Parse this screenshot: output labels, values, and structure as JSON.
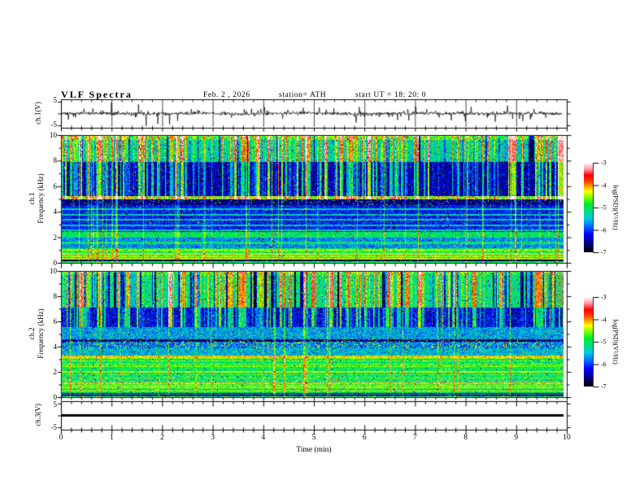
{
  "header": {
    "title": "VLF Spectra",
    "date": "Feb. 2 , 2026",
    "station": "station= ATH",
    "start_ut": "start UT =  18: 20: 0"
  },
  "x_axis": {
    "label": "Time (min)",
    "ticks": [
      "0",
      "1",
      "2",
      "3",
      "4",
      "5",
      "6",
      "7",
      "8",
      "9",
      "10"
    ],
    "range_min": [
      0,
      10
    ],
    "minor_step_min": 0.2
  },
  "panels": {
    "ch1_wave": {
      "ylabel": "ch.1(V)",
      "yticks": [
        "5",
        "-5"
      ],
      "ylim": [
        -5,
        5
      ]
    },
    "spec1": {
      "ylabel_line1": "ch.1",
      "ylabel_line2": "Frequency (kHz)",
      "yticks": [
        "10",
        "8",
        "6",
        "4",
        "2",
        "0"
      ],
      "ylim_khz": [
        0,
        10
      ]
    },
    "spec2": {
      "ylabel_line1": "ch.2",
      "ylabel_line2": "Frequency (kHz)",
      "yticks": [
        "10",
        "8",
        "6",
        "4",
        "2",
        "0"
      ],
      "ylim_khz": [
        0,
        10
      ]
    },
    "ch3_wave": {
      "ylabel": "ch.3(V)",
      "yticks": [
        "5",
        "-5"
      ],
      "ylim": [
        -5,
        5
      ]
    }
  },
  "colorbar": {
    "label": "log(PSD)(V²/Hz)",
    "ticks": [
      "-3",
      "-4",
      "-5",
      "-6",
      "-7"
    ],
    "range": [
      -7,
      -3
    ],
    "colormap": [
      [
        0.0,
        "#000000"
      ],
      [
        0.1,
        "#000085"
      ],
      [
        0.2,
        "#0000ff"
      ],
      [
        0.3,
        "#0077ff"
      ],
      [
        0.38,
        "#00ccdd"
      ],
      [
        0.46,
        "#00dd88"
      ],
      [
        0.54,
        "#00ee22"
      ],
      [
        0.62,
        "#88ff00"
      ],
      [
        0.68,
        "#ffff00"
      ],
      [
        0.74,
        "#ff9900"
      ],
      [
        0.8,
        "#ff3300"
      ],
      [
        0.86,
        "#ff0000"
      ],
      [
        0.93,
        "#ff99aa"
      ],
      [
        1.0,
        "#ffffff"
      ]
    ]
  },
  "chart_data": [
    {
      "type": "line",
      "panel": "ch1-waveform",
      "ylabel": "ch.1(V)",
      "ylim": [
        -5,
        5
      ],
      "x_range_min": [
        0,
        9.85
      ],
      "description": "Noisy time series centered on 0 V with frequent impulsive spikes up to about ±4 V",
      "baseline": 0,
      "noise_sd": 0.5,
      "spike_count": 100,
      "spike_max": 4.3,
      "seed": 5,
      "color": "#000000"
    },
    {
      "type": "heatmap",
      "panel": "ch1-spectrogram",
      "ylabel": "ch.1 Frequency (kHz)",
      "ylim_khz": [
        0,
        10
      ],
      "x_range_min": [
        0,
        9.85
      ],
      "value_range_logpsd": [
        -7,
        -3
      ],
      "seed": 11,
      "bands": [
        {
          "f": [
            5.05,
            5.3
          ],
          "level": -4.55,
          "noise": 0.55
        },
        {
          "f": [
            2.2,
            2.45
          ],
          "level": -5.0,
          "noise": 0.3
        },
        {
          "f": [
            0.95,
            1.1
          ],
          "level": -4.55,
          "noise": 0.3
        },
        {
          "f": [
            0.68,
            0.78
          ],
          "level": -4.3,
          "noise": 0.25
        },
        {
          "f": [
            0.5,
            0.6
          ],
          "level": -4.5,
          "noise": 0.3
        },
        {
          "f": [
            0.32,
            0.42
          ],
          "level": -4.35,
          "noise": 0.3
        },
        {
          "f": [
            0.06,
            0.14
          ],
          "level": -5.0,
          "noise": 0.3
        },
        {
          "f": [
            9.7,
            10.01
          ],
          "level": -4.75,
          "noise": 0.55
        },
        {
          "f": [
            8.0,
            9.7
          ],
          "level": -5.3,
          "noise": 0.5
        },
        {
          "f": [
            5.3,
            8.0
          ],
          "level": -6.45,
          "noise": 0.45
        },
        {
          "f": [
            4.6,
            5.05
          ],
          "level": -6.6,
          "noise": 0.35,
          "speck": {
            "prob": 0.05,
            "level": -4.6
          }
        },
        {
          "f": [
            2.45,
            4.6
          ],
          "level": -6.15,
          "noise": 0.4,
          "stripes": {
            "period": 0.42,
            "frac": 0.3,
            "amp": 0.8
          }
        },
        {
          "f": [
            1.1,
            2.2
          ],
          "level": -5.7,
          "noise": 0.4,
          "stripes": {
            "period": 0.5,
            "frac": 0.4,
            "amp": 0.6
          }
        },
        {
          "f": [
            0.78,
            0.95
          ],
          "level": -4.95,
          "noise": 0.3
        },
        {
          "f": [
            0.6,
            0.68
          ],
          "level": -5.2,
          "noise": 0.3
        },
        {
          "f": [
            0.42,
            0.5
          ],
          "level": -5.1,
          "noise": 0.3
        },
        {
          "f": [
            0.14,
            0.32
          ],
          "level": -6.85,
          "noise": 0.25
        },
        {
          "f": [
            0.0,
            0.06
          ],
          "level": -7.0,
          "noise": 0.1
        }
      ],
      "streaks": {
        "fmin": 5.05,
        "bright_prob": 0.55,
        "bright_amp": 2.1,
        "dark_fmin": 8.0,
        "dark_prob": 0.13,
        "dark_amp": 1.5,
        "full_prob": 0.08,
        "full_amp": 1.25,
        "persist": 0.38
      }
    },
    {
      "type": "heatmap",
      "panel": "ch2-spectrogram",
      "ylabel": "ch.2 Frequency (kHz)",
      "ylim_khz": [
        0,
        10
      ],
      "x_range_min": [
        0,
        9.85
      ],
      "value_range_logpsd": [
        -7,
        -3
      ],
      "seed": 23,
      "bands": [
        {
          "f": [
            4.45,
            4.62
          ],
          "level": -6.7,
          "noise": 0.5,
          "speck": {
            "prob": 0.08,
            "level": -4.3
          }
        },
        {
          "f": [
            3.15,
            3.32
          ],
          "level": -4.2,
          "noise": 0.35
        },
        {
          "f": [
            2.45,
            2.55
          ],
          "level": -4.6,
          "noise": 0.3
        },
        {
          "f": [
            2.0,
            2.12
          ],
          "level": -4.45,
          "noise": 0.3
        },
        {
          "f": [
            1.1,
            1.2
          ],
          "level": -4.15,
          "noise": 0.3
        },
        {
          "f": [
            0.72,
            0.8
          ],
          "level": -4.2,
          "noise": 0.3
        },
        {
          "f": [
            0.47,
            0.55
          ],
          "level": -4.35,
          "noise": 0.3
        },
        {
          "f": [
            0.3,
            0.34
          ],
          "level": -6.5,
          "noise": 0.4
        },
        {
          "f": [
            0.18,
            0.24
          ],
          "level": -6.9,
          "noise": 0.3
        },
        {
          "f": [
            0.06,
            0.11
          ],
          "level": -4.8,
          "noise": 0.55
        },
        {
          "f": [
            9.8,
            10.01
          ],
          "level": -4.85,
          "noise": 0.5
        },
        {
          "f": [
            7.2,
            9.8
          ],
          "level": -5.15,
          "noise": 0.45
        },
        {
          "f": [
            5.6,
            7.2
          ],
          "level": -6.3,
          "noise": 0.45
        },
        {
          "f": [
            4.62,
            5.6
          ],
          "level": -5.6,
          "noise": 0.45
        },
        {
          "f": [
            3.9,
            4.45
          ],
          "level": -5.75,
          "noise": 0.5,
          "speck": {
            "prob": 0.12,
            "level": -4.45
          }
        },
        {
          "f": [
            3.32,
            3.9
          ],
          "level": -5.5,
          "noise": 0.45
        },
        {
          "f": [
            2.55,
            3.15
          ],
          "level": -5.05,
          "noise": 0.35,
          "stripes": {
            "period": 0.22,
            "frac": 0.3,
            "amp": 0.5
          }
        },
        {
          "f": [
            2.12,
            2.45
          ],
          "level": -5.0,
          "noise": 0.35
        },
        {
          "f": [
            1.2,
            2.0
          ],
          "level": -5.15,
          "noise": 0.4,
          "stripes": {
            "period": 0.18,
            "frac": 0.3,
            "amp": 0.45
          }
        },
        {
          "f": [
            0.8,
            1.1
          ],
          "level": -4.85,
          "noise": 0.3,
          "stripes": {
            "period": 0.16,
            "frac": 0.3,
            "amp": 0.4
          }
        },
        {
          "f": [
            0.55,
            0.72
          ],
          "level": -4.9,
          "noise": 0.3
        },
        {
          "f": [
            0.34,
            0.47
          ],
          "level": -4.95,
          "noise": 0.3
        },
        {
          "f": [
            0.24,
            0.3
          ],
          "level": -5.6,
          "noise": 0.4
        },
        {
          "f": [
            0.11,
            0.18
          ],
          "level": -6.3,
          "noise": 0.4
        },
        {
          "f": [
            0.0,
            0.06
          ],
          "level": -7.0,
          "noise": 0.1
        }
      ],
      "streaks": {
        "fmin": 5.6,
        "bright_prob": 0.5,
        "bright_amp": 1.9,
        "dark_fmin": 7.2,
        "dark_prob": 0.3,
        "dark_amp": 2.0,
        "full_prob": 0.06,
        "full_amp": 1.15,
        "persist": 0.42
      }
    },
    {
      "type": "line",
      "panel": "ch3-waveform",
      "ylabel": "ch.3(V)",
      "ylim": [
        -5,
        5
      ],
      "x_range_min": [
        0,
        9.85
      ],
      "description": "Flat constant trace at 0 V drawn as a thick black line",
      "constant": 0,
      "linewidth": 3,
      "color": "#000000"
    }
  ]
}
